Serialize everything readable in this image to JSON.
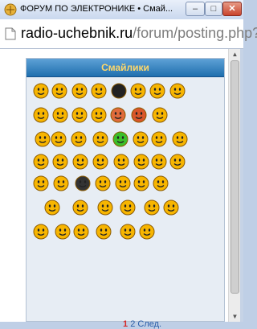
{
  "window": {
    "title": "ФОРУМ ПО ЭЛЕКТРОНИКЕ • Смай...",
    "min_label": "–",
    "max_label": "□",
    "close_label": "✕"
  },
  "address": {
    "domain": "radio-uchebnik.ru",
    "path": "/forum/posting.php?"
  },
  "panel": {
    "title": "Смайлики"
  },
  "pagination": {
    "current": "1",
    "next_page": "2",
    "next_label": "След."
  },
  "colors": {
    "accent": "#2a73b5",
    "smiley": "#f7b500",
    "title_text": "#ffd86a"
  },
  "smileys": [
    {
      "name": "smile-icon",
      "color": "#f7b500"
    },
    {
      "name": "sad-icon",
      "color": "#f7b500"
    },
    {
      "name": "wink-icon",
      "color": "#f7b500"
    },
    {
      "name": "grin-icon",
      "color": "#f7b500"
    },
    {
      "name": "angry-black-icon",
      "color": "#222222"
    },
    {
      "name": "laugh-icon",
      "color": "#f7b500"
    },
    {
      "name": "cool-sunglasses-icon",
      "color": "#f7b500"
    },
    {
      "name": "tongue-icon",
      "color": "#f7b500"
    },
    {
      "name": "crazy-icon",
      "color": "#f7b500"
    },
    {
      "name": "rolleyes-icon",
      "color": "#f7b500"
    },
    {
      "name": "surprised-icon",
      "color": "#f7b500"
    },
    {
      "name": "eek-icon",
      "color": "#f7b500"
    },
    {
      "name": "red-angry-icon",
      "color": "#e06b3c"
    },
    {
      "name": "devil-icon",
      "color": "#d9562a"
    },
    {
      "name": "mad-icon",
      "color": "#f7b500"
    },
    {
      "name": "exclamation-icon",
      "color": "#f7b500"
    },
    {
      "name": "question-icon",
      "color": "#f7b500"
    },
    {
      "name": "idea-icon",
      "color": "#f7b500"
    },
    {
      "name": "arrow-icon",
      "color": "#f7b500"
    },
    {
      "name": "green-sick-icon",
      "color": "#3bbf2a"
    },
    {
      "name": "sunglasses-icon",
      "color": "#f7b500"
    },
    {
      "name": "dark-glasses-icon",
      "color": "#f7b500"
    },
    {
      "name": "yawn-icon",
      "color": "#f7b500"
    },
    {
      "name": "whistle-icon",
      "color": "#f7b500"
    },
    {
      "name": "group-icon",
      "color": "#f7b500"
    },
    {
      "name": "shy-icon",
      "color": "#f7b500"
    },
    {
      "name": "dance-icon",
      "color": "#f7b500"
    },
    {
      "name": "love-icon",
      "color": "#f7b500"
    },
    {
      "name": "think-icon",
      "color": "#f7b500"
    },
    {
      "name": "drink-icon",
      "color": "#f7b500"
    },
    {
      "name": "headphones-icon",
      "color": "#f7b500"
    },
    {
      "name": "blush-icon",
      "color": "#f7b500"
    },
    {
      "name": "pirate-icon",
      "color": "#f7b500"
    },
    {
      "name": "bomb-icon",
      "color": "#333333"
    },
    {
      "name": "evil-icon",
      "color": "#f7b500"
    },
    {
      "name": "kiss-icon",
      "color": "#f7b500"
    },
    {
      "name": "hat-icon",
      "color": "#f7b500"
    },
    {
      "name": "thumbs-up-icon",
      "color": "#f7b500"
    },
    {
      "name": "wave-icon",
      "color": "#f7b500"
    },
    {
      "name": "nerd-icon",
      "color": "#f7b500"
    },
    {
      "name": "cry-icon",
      "color": "#f7b500"
    },
    {
      "name": "rose-icon",
      "color": "#f7b500"
    },
    {
      "name": "clap-icon",
      "color": "#f7b500"
    },
    {
      "name": "sleep-icon",
      "color": "#f7b500"
    },
    {
      "name": "flower-icon",
      "color": "#f7b500"
    },
    {
      "name": "angel-icon",
      "color": "#f7b500"
    },
    {
      "name": "sick-icon",
      "color": "#f7b500"
    },
    {
      "name": "punch-icon",
      "color": "#f7b500"
    },
    {
      "name": "ok-icon",
      "color": "#f7b500"
    },
    {
      "name": "dizzy-icon",
      "color": "#f7b500"
    }
  ]
}
